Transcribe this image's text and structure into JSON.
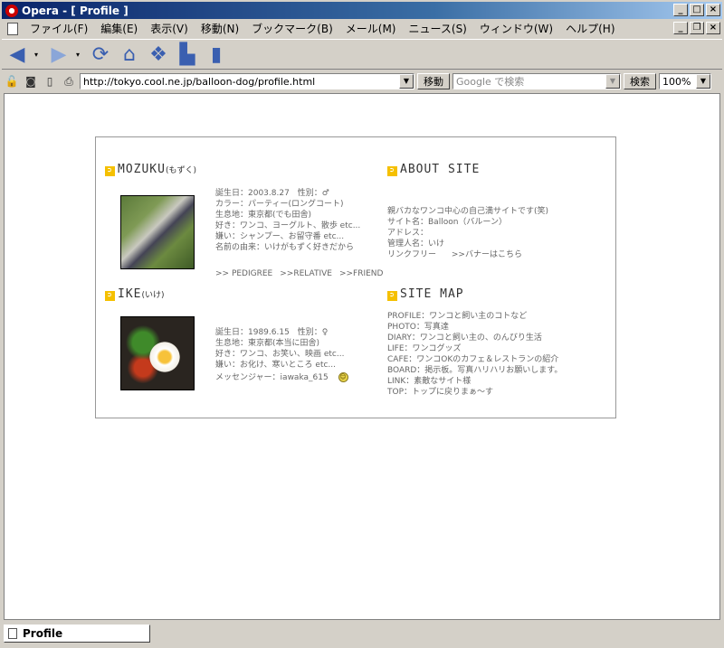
{
  "window": {
    "title": "Opera - [ Profile ]"
  },
  "menu": [
    "ファイル(F)",
    "編集(E)",
    "表示(V)",
    "移動(N)",
    "ブックマーク(B)",
    "メール(M)",
    "ニュース(S)",
    "ウィンドウ(W)",
    "ヘルプ(H)"
  ],
  "toolbar": {
    "back": "back-arrow-icon",
    "forward": "forward-arrow-icon",
    "reload": "reload-icon",
    "home": "home-icon",
    "hotlist": "hotlist-icon",
    "print": "print-icon",
    "page": "page-icon"
  },
  "address": {
    "url": "http://tokyo.cool.ne.jp/balloon-dog/profile.html",
    "go_label": "移動",
    "search_placeholder": "Google で検索",
    "search_label": "検索",
    "zoom": "100%"
  },
  "page": {
    "mozuku": {
      "name": "MOZUKU",
      "reading": "(もずく)",
      "lines": [
        "誕生日：2003.8.27　性別：♂",
        "カラー：パーティー(ロングコート)",
        "生息地：東京都(でも田舎)",
        "好き：ワンコ、ヨーグルト、散歩 etc...",
        "嫌い：シャンプー、お留守番 etc...",
        "名前の由来：いけがもずく好きだから"
      ],
      "links": [
        ">> PEDIGREE",
        ">>RELATIVE",
        ">>FRIEND"
      ]
    },
    "ike": {
      "name": "IKE",
      "reading": "(いけ)",
      "lines": [
        "誕生日：1989.6.15　性別：♀",
        "生息地：東京都(本当に田舎)",
        "好き：ワンコ、お笑い、映画 etc...",
        "嫌い：お化け、寒いところ etc..."
      ],
      "messenger": "メッセンジャー：iawaka_615"
    },
    "about": {
      "title": "ABOUT SITE",
      "lines": [
        "親バカなワンコ中心の自己満サイトです(笑)",
        "サイト名：Balloon（バルーン）",
        "アドレス：",
        "管理人名：いけ"
      ],
      "linkfree": "リンクフリー",
      "banner": ">>バナーはこちら"
    },
    "sitemap": {
      "title": "SITE MAP",
      "lines": [
        "PROFILE：ワンコと飼い主のコトなど",
        "PHOTO：写真達",
        "DIARY：ワンコと飼い主の、のんびり生活",
        "LIFE：ワンコグッズ",
        "CAFE：ワンコOKのカフェ＆レストランの紹介",
        "BOARD：掲示板。写真ハリハリお願いします。",
        "LINK：素敵なサイト様",
        "TOP：トップに戻りまぁ～す"
      ]
    }
  },
  "status": {
    "tab_label": "Profile"
  }
}
